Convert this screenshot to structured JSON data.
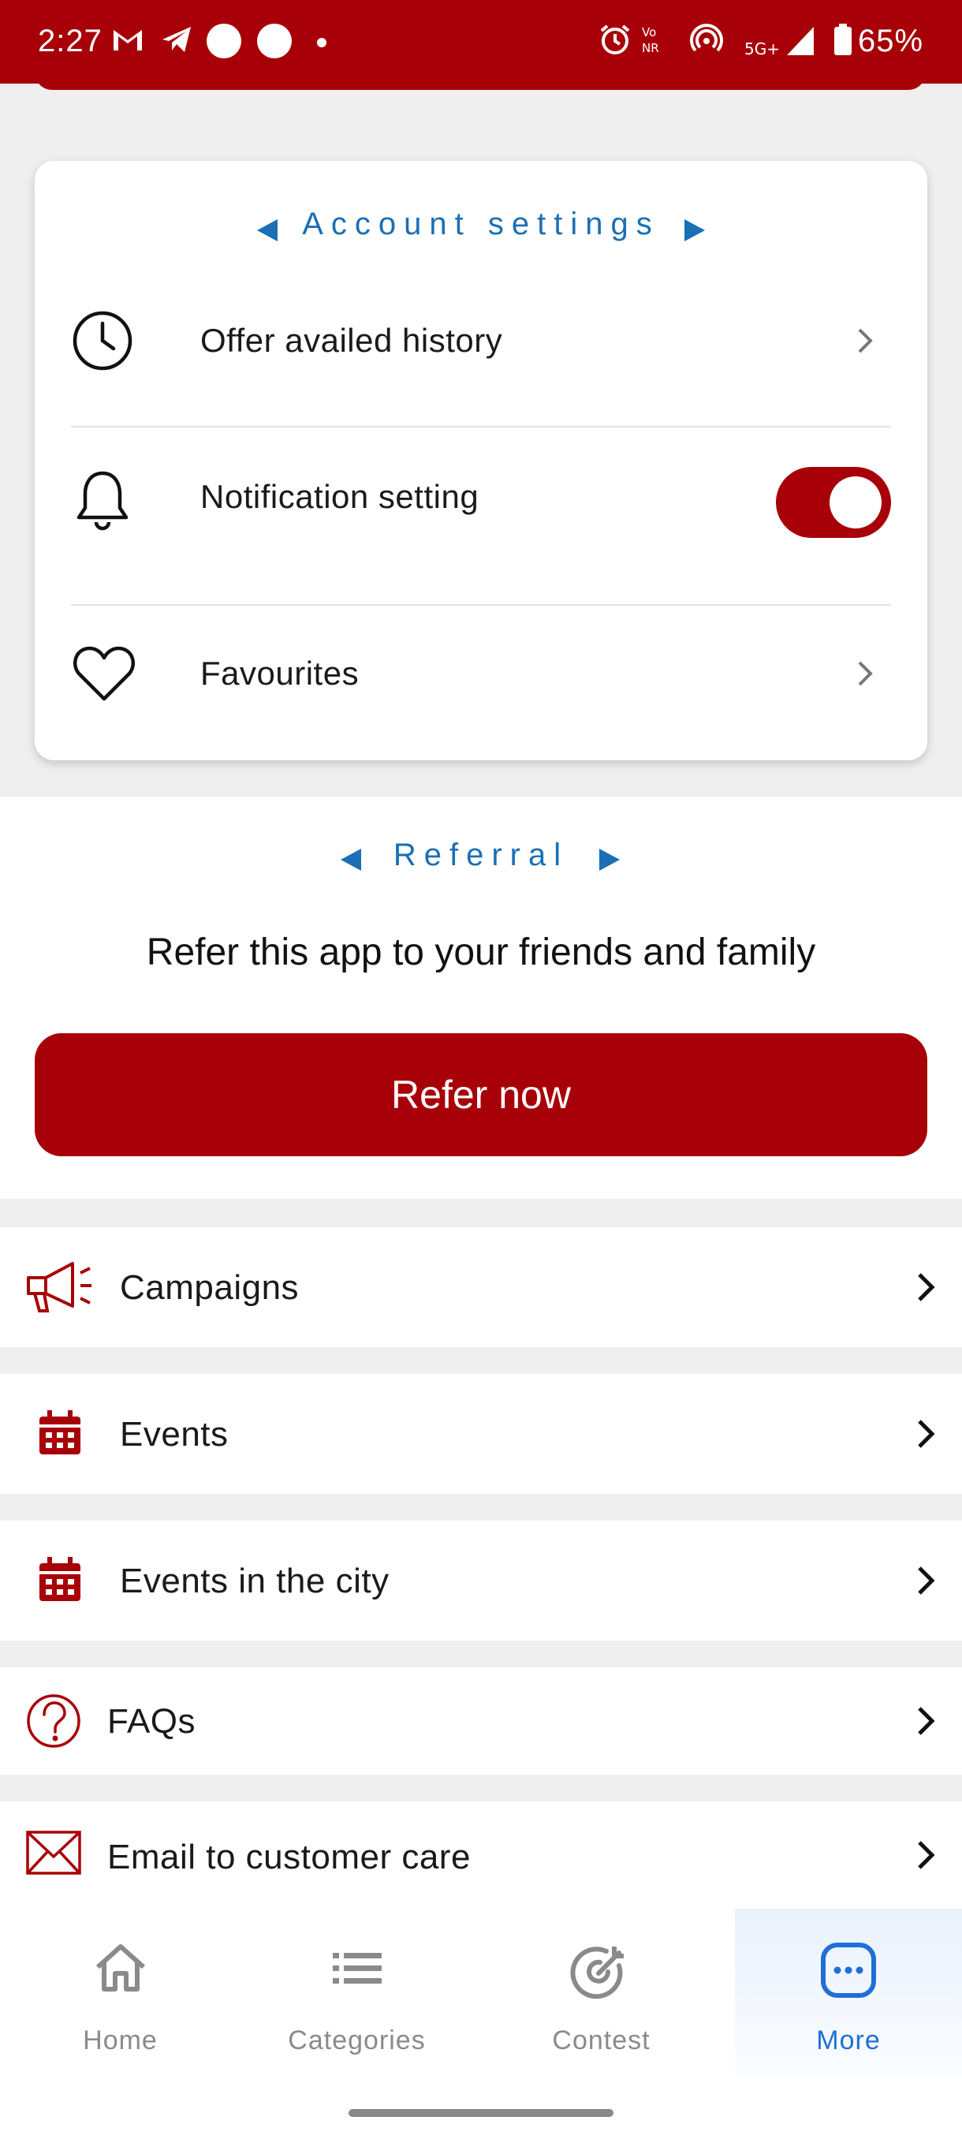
{
  "status_bar": {
    "time": "2:27",
    "battery": "65%",
    "network": "5G+"
  },
  "account_settings": {
    "title": "Account settings",
    "items": [
      {
        "label": "Offer availed history",
        "icon": "clock-icon",
        "action": "chevron"
      },
      {
        "label": "Notification setting",
        "icon": "bell-icon",
        "action": "toggle",
        "toggle_on": true
      },
      {
        "label": "Favourites",
        "icon": "heart-icon",
        "action": "chevron"
      }
    ]
  },
  "referral": {
    "title": "Referral",
    "description": "Refer this app to your friends and family",
    "button_label": "Refer now"
  },
  "menu": {
    "items": [
      {
        "label": "Campaigns",
        "icon": "megaphone-icon"
      },
      {
        "label": "Events",
        "icon": "calendar-icon"
      },
      {
        "label": "Events in the city",
        "icon": "calendar-icon"
      },
      {
        "label": "FAQs",
        "icon": "question-icon"
      },
      {
        "label": "Email to customer care",
        "icon": "envelope-icon"
      }
    ]
  },
  "bottom_nav": {
    "items": [
      {
        "label": "Home",
        "icon": "home-icon"
      },
      {
        "label": "Categories",
        "icon": "list-icon"
      },
      {
        "label": "Contest",
        "icon": "target-icon"
      },
      {
        "label": "More",
        "icon": "more-icon",
        "active": true
      }
    ]
  },
  "colors": {
    "brand": "#a80008",
    "accent_blue": "#1a6fb5",
    "nav_active": "#1f6fd6",
    "background": "#efefef"
  }
}
